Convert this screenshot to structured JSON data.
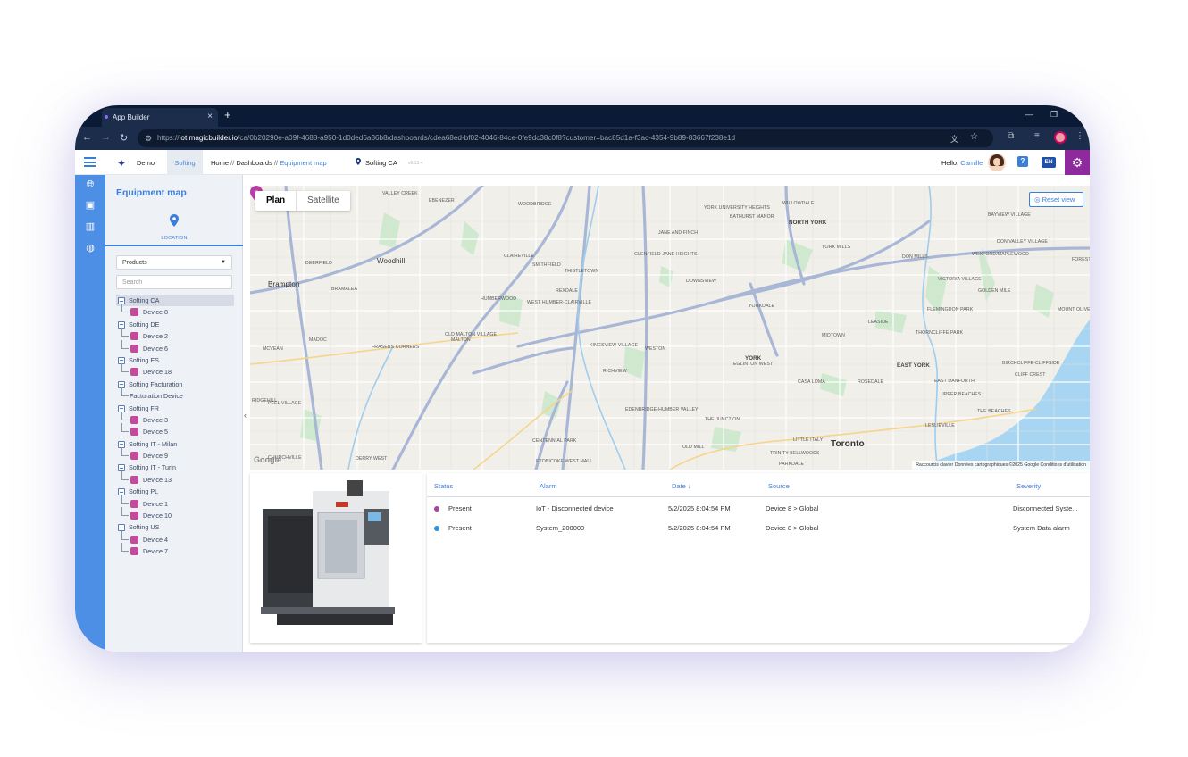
{
  "browser": {
    "tab_title": "App Builder",
    "url_prefix": "https://",
    "url_domain": "iot.magicbuilder.io",
    "url_path": "/ca/0b20290e-a09f-4688-a950-1d0ded6a36b8/dashboards/cdea68ed-bf02-4046-84ce-0fe9dc38c0f8?customer=bac85d1a-f3ac-4354-9b89-83667f238e1d"
  },
  "header": {
    "demo_label": "Demo",
    "softing_label": "Softing",
    "crumb_home": "Home",
    "crumb_sep": "//",
    "crumb_dashboards": "Dashboards",
    "crumb_current": "Equipment map",
    "site": "Softing CA",
    "version": "v8.13.4",
    "hello": "Hello,",
    "user": "Camille",
    "help": "?",
    "lang": "EN"
  },
  "panel": {
    "title": "Equipment map",
    "location_label": "LOCATION",
    "select_value": "Products",
    "search_placeholder": "Search",
    "tree": [
      {
        "type": "group",
        "label": "Softing CA",
        "selected": true
      },
      {
        "type": "device",
        "label": "Device 8"
      },
      {
        "type": "group",
        "label": "Softing DE"
      },
      {
        "type": "device",
        "label": "Device 2"
      },
      {
        "type": "device",
        "label": "Device 6"
      },
      {
        "type": "group",
        "label": "Softing ES"
      },
      {
        "type": "device",
        "label": "Device 18"
      },
      {
        "type": "group",
        "label": "Softing Facturation"
      },
      {
        "type": "plain",
        "label": "Facturation Device"
      },
      {
        "type": "group",
        "label": "Softing FR"
      },
      {
        "type": "device",
        "label": "Device 3"
      },
      {
        "type": "device",
        "label": "Device 5"
      },
      {
        "type": "group",
        "label": "Softing IT - Milan"
      },
      {
        "type": "device",
        "label": "Device 9"
      },
      {
        "type": "group",
        "label": "Softing IT - Turin"
      },
      {
        "type": "device",
        "label": "Device 13"
      },
      {
        "type": "group",
        "label": "Softing PL"
      },
      {
        "type": "device",
        "label": "Device 1"
      },
      {
        "type": "device",
        "label": "Device 10"
      },
      {
        "type": "group",
        "label": "Softing US"
      },
      {
        "type": "device",
        "label": "Device 4"
      },
      {
        "type": "device",
        "label": "Device 7"
      }
    ]
  },
  "map": {
    "tab_plan": "Plan",
    "tab_satellite": "Satellite",
    "reset_label": "Reset view",
    "google": "Google",
    "attribution": "Raccourcis clavier   Données cartographiques ©2025 Google   Conditions d'utilisation",
    "labels": [
      "VALLEY CREEK",
      "EBENEZER",
      "WOODBRIDGE",
      "YORK UNIVERSITY HEIGHTS",
      "BATHURST MANOR",
      "WILLOWDALE",
      "NORTH YORK",
      "BAYVIEW VILLAGE",
      "DON VALLEY VILLAGE",
      "FOREST PARK",
      "CLAIREVILLE",
      "SMITHFIELD",
      "THISTLETOWN",
      "GLENFIELD-JANE HEIGHTS",
      "JANE AND FINCH",
      "YORK MILLS",
      "DON MILLS",
      "Woodhill",
      "Brampton",
      "BRAMALEA",
      "DEERFIELD",
      "HUMBERWOOD",
      "WEST HUMBER-CLAIRVILLE",
      "REXDALE",
      "DOWNSVIEW",
      "YORKDALE",
      "VICTORIA VILLAGE",
      "GOLDEN MILE",
      "MOUNT OLIVE",
      "WEXFORD/MAPLEWOOD",
      "FLEMINGDON PARK",
      "LEASIDE",
      "THORNCLIFFE PARK",
      "MIDTOWN",
      "YORK",
      "EAST YORK",
      "BIRCHCLIFFE-CLIFFSIDE",
      "CLIFF CREST",
      "OLD MALTON VILLAGE",
      "MALTON",
      "KINGSVIEW VILLAGE",
      "WESTON",
      "EGLINTON WEST",
      "CASA LOMA",
      "ROSEDALE",
      "EAST DANFORTH",
      "UPPER BEACHES",
      "THE BEACHES",
      "LESLIEVILLE",
      "FRASERS CORNERS",
      "RICHVIEW",
      "EDENBRIDGE-HUMBER VALLEY",
      "THE JUNCTION",
      "RIDGEHILL",
      "PEEL VILLAGE",
      "CENTENNIAL PARK",
      "ETOBICOKE WEST MALL",
      "OLD MILL",
      "LITTLE ITALY",
      "TRINITY-BELLWOODS",
      "Toronto",
      "CHURCHVILLE",
      "DERRY WEST",
      "PARKDALE",
      "MADOC",
      "MCVEAN"
    ]
  },
  "alarms": {
    "headers": {
      "status": "Status",
      "alarm": "Alarm",
      "date": "Date",
      "sort": "↓",
      "source": "Source",
      "severity": "Severity"
    },
    "rows": [
      {
        "status": "Present",
        "alarm": "IoT - Disconnected device",
        "date": "5/2/2025 8:04:54 PM",
        "source": "Device 8 > Global",
        "severity": "Disconnected Syste...",
        "color": "#a3479d"
      },
      {
        "status": "Present",
        "alarm": "System_200000",
        "date": "5/2/2025 8:04:54 PM",
        "source": "Device 8 > Global",
        "severity": "System Data alarm",
        "color": "#2f8fd8"
      }
    ]
  },
  "colors": {
    "accent": "#3d7ed8",
    "rail": "#4e8fe6",
    "gear": "#8e2a9e",
    "pin": "#b53ea6"
  }
}
